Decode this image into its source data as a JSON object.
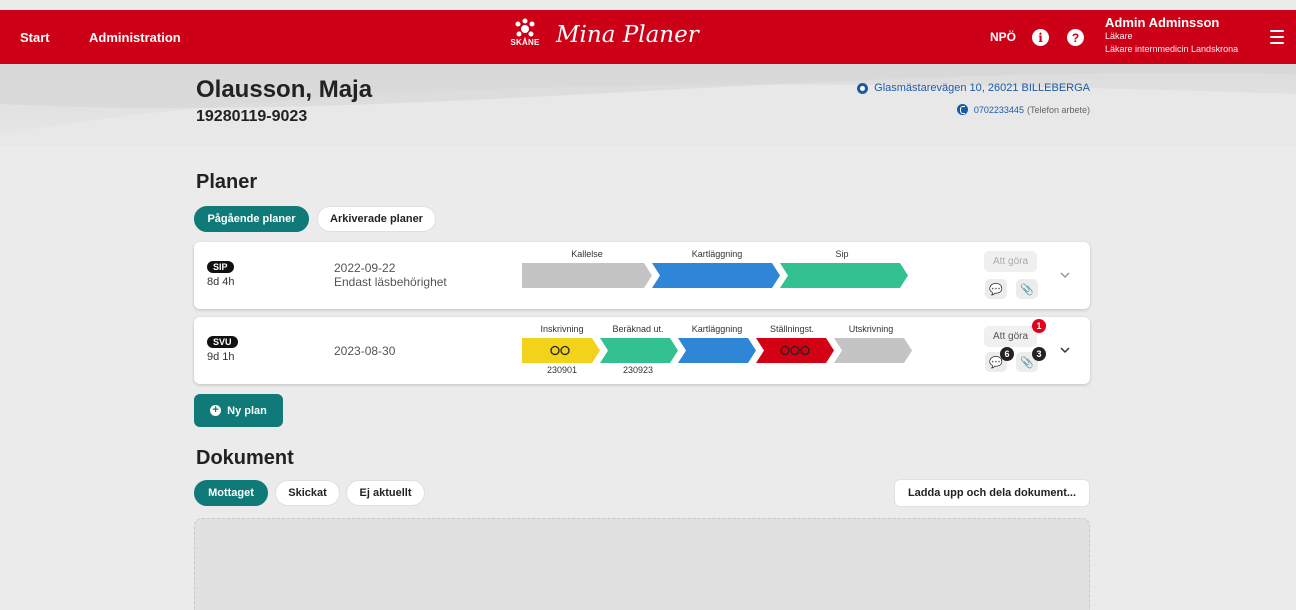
{
  "header": {
    "nav_start": "Start",
    "nav_admin": "Administration",
    "logo_text": "SKÅNE",
    "app_title": "Mina Planer",
    "npo": "NPÖ",
    "info_glyph": "i",
    "help_glyph": "?",
    "user_name": "Admin Adminsson",
    "user_role": "Läkare",
    "user_unit": "Läkare internmedicin Landskrona"
  },
  "patient": {
    "name": "Olausson, Maja",
    "personnummer": "19280119-9023",
    "address": "Glasmästarevägen 10, 26021 BILLEBERGA",
    "phone": "0702233445",
    "phone_type": "(Telefon arbete)"
  },
  "plans": {
    "heading": "Planer",
    "tab_active": "Pågående planer",
    "tab_archived": "Arkiverade planer",
    "items": [
      {
        "badge": "SIP",
        "duration": "8d 4h",
        "date": "2022-09-22",
        "access_note": "Endast läsbehörighet",
        "steps": [
          "Kallelse",
          "Kartläggning",
          "Sip"
        ],
        "todo": "Att göra"
      },
      {
        "badge": "SVU",
        "duration": "9d 1h",
        "date": "2023-08-30",
        "steps": [
          "Inskrivning",
          "Beräknad ut.",
          "Kartläggning",
          "Ställningst.",
          "Utskrivning"
        ],
        "step_dates": [
          "230901",
          "230923"
        ],
        "todo": "Att göra",
        "todo_count": "1",
        "comments_count": "6",
        "attachments_count": "3"
      }
    ],
    "new_plan": "Ny plan"
  },
  "documents": {
    "heading": "Dokument",
    "tab_received": "Mottaget",
    "tab_sent": "Skickat",
    "tab_not_current": "Ej aktuellt",
    "upload_button": "Ladda upp och dela dokument..."
  },
  "colors": {
    "brand_red": "#cc0017",
    "teal": "#0f7a78",
    "step_gray": "#c4c4c4",
    "step_blue": "#2f86d6",
    "step_green": "#33c191",
    "step_yellow": "#f2d21b",
    "step_red": "#d40014"
  }
}
